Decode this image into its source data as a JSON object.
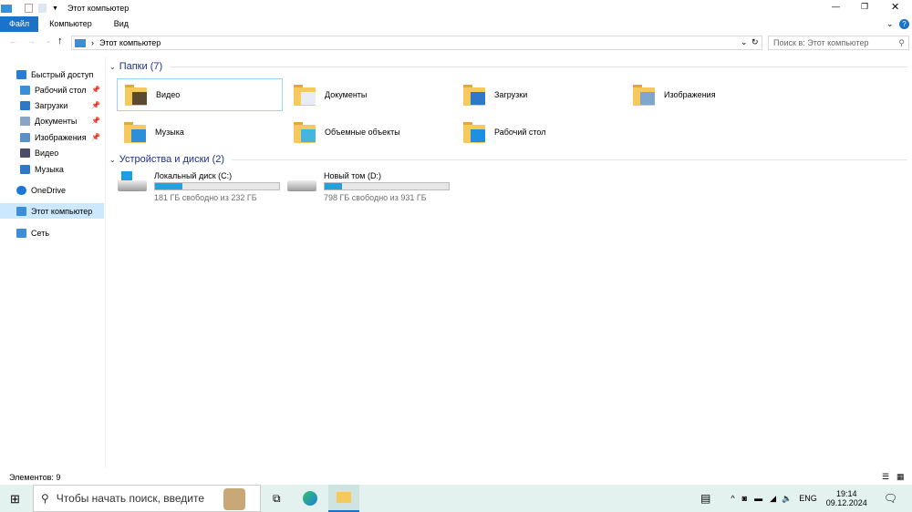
{
  "window": {
    "title": "Этот компьютер"
  },
  "ribbon": {
    "tabs": [
      "Файл",
      "Компьютер",
      "Вид"
    ]
  },
  "address": {
    "path": "Этот компьютер",
    "search_placeholder": "Поиск в: Этот компьютер"
  },
  "nav": {
    "items": [
      {
        "label": "Быстрый доступ",
        "color": "#2b7cd3"
      },
      {
        "label": "Рабочий стол",
        "color": "#3a8fd8",
        "pinned": true
      },
      {
        "label": "Загрузки",
        "color": "#2d79c7",
        "pinned": true
      },
      {
        "label": "Документы",
        "color": "#8ba4c6",
        "pinned": true
      },
      {
        "label": "Изображения",
        "color": "#5b8fc7",
        "pinned": true
      },
      {
        "label": "Видео",
        "color": "#4a4a6a"
      },
      {
        "label": "Музыка",
        "color": "#2d79c7"
      },
      {
        "label": "OneDrive",
        "color": "#1e78d3"
      },
      {
        "label": "Этот компьютер",
        "color": "#3a8fd8"
      },
      {
        "label": "Сеть",
        "color": "#3a8fd8"
      }
    ]
  },
  "folders": {
    "header": "Папки (7)",
    "items": [
      {
        "label": "Видео",
        "overlay": "#5a4a30"
      },
      {
        "label": "Документы",
        "overlay": "#e8edf5"
      },
      {
        "label": "Загрузки",
        "overlay": "#2d79c7"
      },
      {
        "label": "Изображения",
        "overlay": "#7fa6cc"
      },
      {
        "label": "Музыка",
        "overlay": "#2d8fd8"
      },
      {
        "label": "Объемные объекты",
        "overlay": "#45b5e0"
      },
      {
        "label": "Рабочий стол",
        "overlay": "#1e90e0"
      }
    ]
  },
  "drives": {
    "header": "Устройства и диски (2)",
    "items": [
      {
        "label": "Локальный диск (C:)",
        "free": "181 ГБ свободно из 232 ГБ",
        "used_percent": 22
      },
      {
        "label": "Новый том (D:)",
        "free": "798 ГБ свободно из 931 ГБ",
        "used_percent": 14
      }
    ]
  },
  "status": {
    "count": "Элементов: 9"
  },
  "taskbar": {
    "search_placeholder": "Чтобы начать поиск, введите",
    "lang": "ENG",
    "time": "19:14",
    "date": "09.12.2024"
  }
}
